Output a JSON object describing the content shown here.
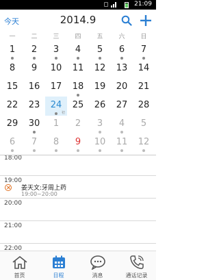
{
  "status_bar": {
    "time": "21:09"
  },
  "header": {
    "today_label": "今天",
    "month_title": "2014.9"
  },
  "weekdays": [
    "一",
    "二",
    "三",
    "四",
    "五",
    "六",
    "日"
  ],
  "calendar": {
    "weeks": [
      [
        {
          "n": "1",
          "d": true
        },
        {
          "n": "2",
          "d": true
        },
        {
          "n": "3",
          "d": true
        },
        {
          "n": "4",
          "d": true
        },
        {
          "n": "5",
          "d": true
        },
        {
          "n": "6",
          "d": true
        },
        {
          "n": "7",
          "d": true
        }
      ],
      [
        {
          "n": "8",
          "d": false
        },
        {
          "n": "9",
          "d": false
        },
        {
          "n": "10",
          "d": false
        },
        {
          "n": "11",
          "d": false
        },
        {
          "n": "12",
          "d": false
        },
        {
          "n": "13",
          "d": false
        },
        {
          "n": "14",
          "d": false
        }
      ],
      [
        {
          "n": "15",
          "d": false
        },
        {
          "n": "16",
          "d": false
        },
        {
          "n": "17",
          "d": false
        },
        {
          "n": "18",
          "d": true
        },
        {
          "n": "19",
          "d": false
        },
        {
          "n": "20",
          "d": false
        },
        {
          "n": "21",
          "d": false
        }
      ],
      [
        {
          "n": "22",
          "d": false
        },
        {
          "n": "23",
          "d": false
        },
        {
          "n": "24",
          "d": true,
          "sel": true,
          "sub": "初"
        },
        {
          "n": "25",
          "d": false
        },
        {
          "n": "26",
          "d": false
        },
        {
          "n": "27",
          "d": false
        },
        {
          "n": "28",
          "d": false
        }
      ],
      [
        {
          "n": "29",
          "d": false
        },
        {
          "n": "30",
          "d": true
        },
        {
          "n": "1",
          "d": false,
          "o": true
        },
        {
          "n": "2",
          "d": false,
          "o": true
        },
        {
          "n": "3",
          "d": true,
          "o": true
        },
        {
          "n": "4",
          "d": true,
          "o": true
        },
        {
          "n": "5",
          "d": false,
          "o": true
        }
      ],
      [
        {
          "n": "6",
          "d": true,
          "o": true
        },
        {
          "n": "7",
          "d": true,
          "o": true
        },
        {
          "n": "8",
          "d": true,
          "o": true
        },
        {
          "n": "9",
          "d": true,
          "o": true,
          "h": true
        },
        {
          "n": "10",
          "d": true,
          "o": true
        },
        {
          "n": "11",
          "d": true,
          "o": true
        },
        {
          "n": "12",
          "d": true,
          "o": true
        }
      ]
    ]
  },
  "timeline": {
    "hours": [
      "18:00",
      "19:00",
      "20:00",
      "21:00",
      "22:00"
    ],
    "event": {
      "title": "姜天文:牙周上药",
      "time": "19:00~20:00"
    }
  },
  "tabs": [
    {
      "label": "首页",
      "icon": "home-icon"
    },
    {
      "label": "日程",
      "icon": "calendar-icon",
      "active": true
    },
    {
      "label": "消息",
      "icon": "message-icon"
    },
    {
      "label": "通话记录",
      "icon": "phone-icon"
    }
  ],
  "colors": {
    "accent": "#2b7fd3",
    "selected_bg": "#dff0fb",
    "holiday": "#d33333",
    "event_icon": "#e07020"
  }
}
